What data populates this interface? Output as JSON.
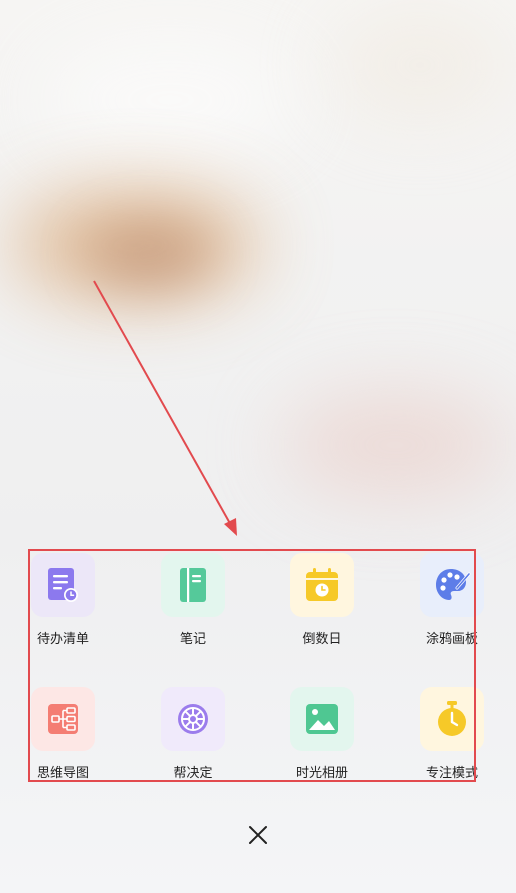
{
  "apps": [
    {
      "id": "todo",
      "label": "待办清单",
      "icon": "todo-list-icon",
      "tile_color": "#ece7f8",
      "icon_color": "#8c79ee"
    },
    {
      "id": "note",
      "label": "笔记",
      "icon": "notebook-icon",
      "tile_color": "#e3f6ee",
      "icon_color": "#55c99a"
    },
    {
      "id": "countdown",
      "label": "倒数日",
      "icon": "calendar-clock-icon",
      "tile_color": "#fff6df",
      "icon_color": "#f6c928"
    },
    {
      "id": "doodle",
      "label": "涂鸦画板",
      "icon": "palette-icon",
      "tile_color": "#e8eefb",
      "icon_color": "#5d7de8"
    },
    {
      "id": "mindmap",
      "label": "思维导图",
      "icon": "mind-map-icon",
      "tile_color": "#fde7e5",
      "icon_color": "#f47d73"
    },
    {
      "id": "decide",
      "label": "帮决定",
      "icon": "wheel-icon",
      "tile_color": "#f0eafb",
      "icon_color": "#9b7cec"
    },
    {
      "id": "album",
      "label": "时光相册",
      "icon": "photo-album-icon",
      "tile_color": "#e3f6ee",
      "icon_color": "#4fc792"
    },
    {
      "id": "focus",
      "label": "专注模式",
      "icon": "stopwatch-icon",
      "tile_color": "#fff6df",
      "icon_color": "#f6c928"
    }
  ],
  "annotation": {
    "box_color": "#e24a4e",
    "arrow_color": "#e24a4e"
  },
  "close_button": {
    "icon": "close-icon"
  }
}
